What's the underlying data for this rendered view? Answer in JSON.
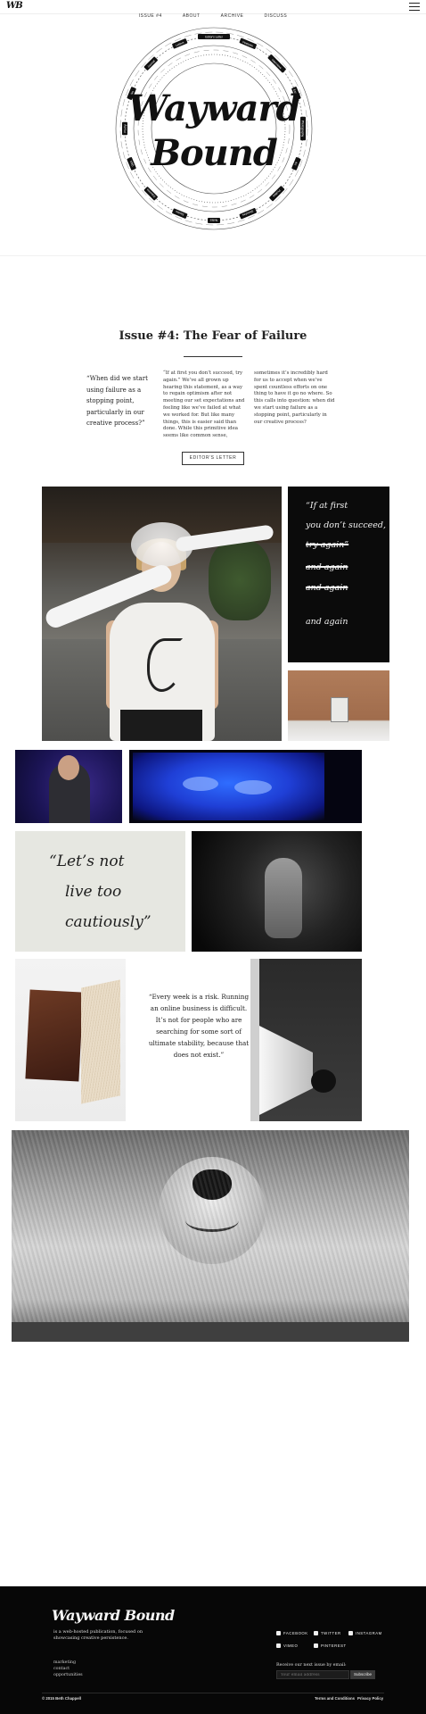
{
  "header": {
    "logo_mark": "WB",
    "nav": [
      "ISSUE #4",
      "ABOUT",
      "ARCHIVE",
      "DISCUSS"
    ]
  },
  "hero": {
    "title_line1": "Wayward",
    "title_line2": "Bound",
    "ring_labels": [
      "Editor's Letter",
      "Features",
      "Interviews",
      "Essays",
      "Photography",
      "Art",
      "Profiles",
      "Sketches",
      "Notes",
      "Stories",
      "Columns",
      "Q&A",
      "Poetry",
      "Film",
      "Journal",
      "Letters"
    ]
  },
  "issue": {
    "title": "Issue #4: The Fear of Failure",
    "pull_quote": "“When did we start using failure as a stopping point, particularly in our creative process?”",
    "col1": "“If at first you don’t succeed, try again.” We’ve all grown up hearing this statement, as a way to regain optimism after not meeting our set expectations and feeling like we’ve failed at what we worked for. But like many things, this is easier said than done. While this primitive idea seems like common sense,",
    "col2": "sometimes it’s incredibly hard for us to accept when we’ve spent countless efforts on one thing to have it go no where. So this calls into question: when did we start using failure as a stopping point, particularly in our creative process?",
    "editor_button": "EDITOR'S LETTER"
  },
  "gallery": {
    "first_card": {
      "line1": "“If at first",
      "line2": "you don’t succeed,",
      "line3": "try again”",
      "line4": "and again",
      "line5": "and again",
      "line6": "and again"
    },
    "notes_card": {
      "line1": "“Let’s not",
      "line2": "live too",
      "line3": "cautiously”"
    },
    "quote": "“Every week is a risk. Running an online business is difficult. It’s not for people who are searching for some sort of ultimate stability, because that does not exist.”"
  },
  "footer": {
    "logo": "Wayward Bound",
    "description": "is a web-hosted publication, focused on showcasing creative persistence.",
    "links": [
      "marketing",
      "contact",
      "opportunities"
    ],
    "social": {
      "facebook": "FACEBOOK",
      "twitter": "TWITTER",
      "instagram": "INSTAGRAM",
      "vimeo": "VIMEO",
      "pinterest": "PINTEREST"
    },
    "subscribe_label": "Receive our next issue by email:",
    "subscribe_placeholder": "Your email address",
    "subscribe_button": "Subscribe",
    "copyright": "© 2015 Beth Chappell",
    "terms": "Terms and Conditions",
    "privacy": "Privacy Policy"
  }
}
